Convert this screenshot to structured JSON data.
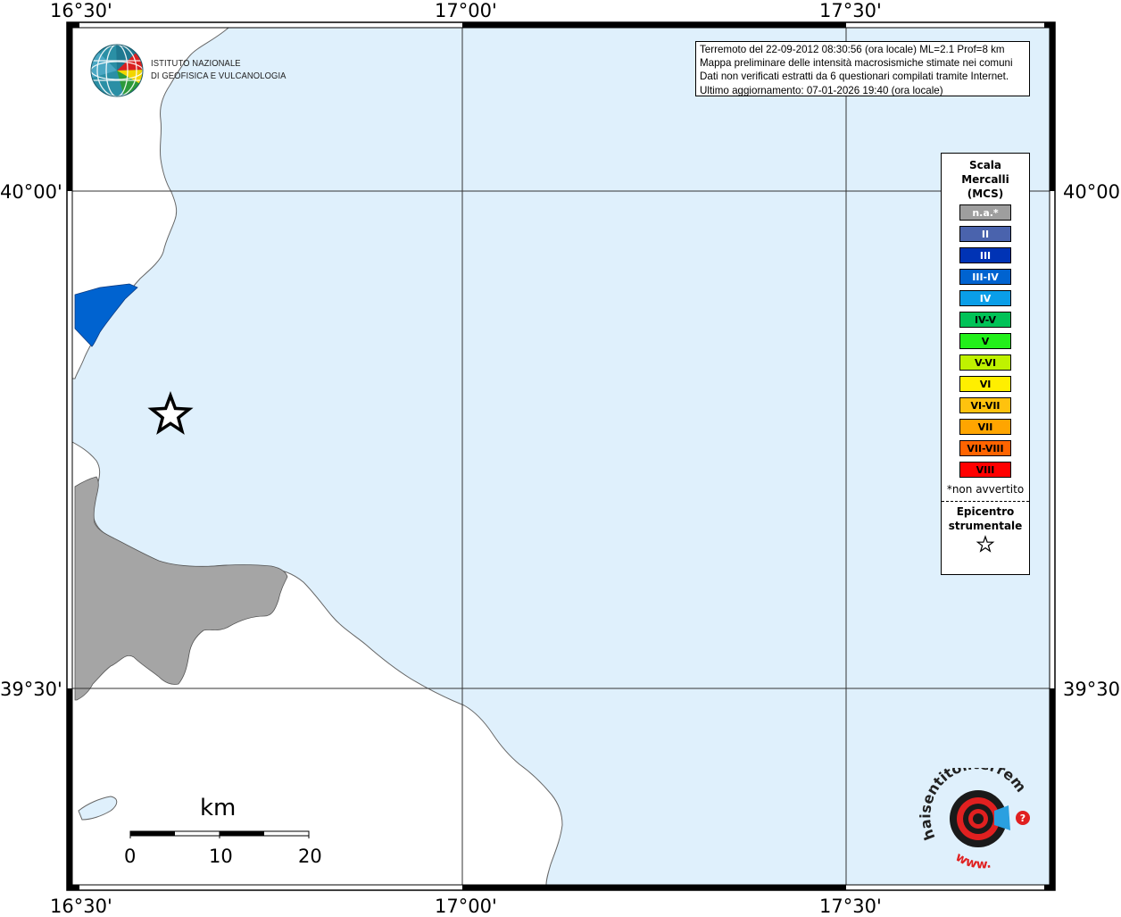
{
  "coords": {
    "top": [
      "16°30'",
      "17°00'",
      "17°30'"
    ],
    "bottom": [
      "16°30'",
      "17°00'",
      "17°30'"
    ],
    "left": [
      "40°00'",
      "39°30'"
    ],
    "right": [
      "40°00'",
      "39°30'"
    ]
  },
  "info": {
    "line1": "Terremoto del 22-09-2012 08:30:56 (ora locale) ML=2.1 Prof=8 km",
    "line2": "Mappa preliminare delle intensità macrosismiche stimate nei comuni",
    "line3": "Dati non verificati estratti da 6 questionari compilati tramite Internet.",
    "line4": "Ultimo aggiornamento: 07-01-2026 19:40 (ora locale)"
  },
  "logo": {
    "line1": "ISTITUTO NAZIONALE",
    "line2": "DI GEOFISICA E VULCANOLOGIA"
  },
  "legend": {
    "title": "Scala\nMercalli\n(MCS)",
    "items": [
      {
        "label": "n.a.*",
        "color": "#9e9e9e",
        "text_color": "#ffffff"
      },
      {
        "label": "II",
        "color": "#4a63ad",
        "text_color": "#ffffff"
      },
      {
        "label": "III",
        "color": "#0033b5",
        "text_color": "#ffffff"
      },
      {
        "label": "III-IV",
        "color": "#0063d0",
        "text_color": "#ffffff"
      },
      {
        "label": "IV",
        "color": "#0a9ee8",
        "text_color": "#ffffff"
      },
      {
        "label": "IV-V",
        "color": "#00c257",
        "text_color": "#000000"
      },
      {
        "label": "V",
        "color": "#22f01a",
        "text_color": "#000000"
      },
      {
        "label": "V-VI",
        "color": "#bff200",
        "text_color": "#000000"
      },
      {
        "label": "VI",
        "color": "#ffef00",
        "text_color": "#000000"
      },
      {
        "label": "VI-VII",
        "color": "#ffc20e",
        "text_color": "#000000"
      },
      {
        "label": "VII",
        "color": "#ffa500",
        "text_color": "#000000"
      },
      {
        "label": "VII-VIII",
        "color": "#ff6400",
        "text_color": "#000000"
      },
      {
        "label": "VIII",
        "color": "#ff0000",
        "text_color": "#000000"
      }
    ],
    "note": "*non avvertito",
    "epicenter_label": "Epicentro\nstrumentale"
  },
  "scale": {
    "unit": "km",
    "ticks": [
      "0",
      "10",
      "20"
    ]
  },
  "colors": {
    "sea": "#dff0fc",
    "land": "#ffffff",
    "not_felt": "#a5a5a5",
    "intensity_zone": "#0063d0"
  },
  "badge": {
    "text_top": "haisentitoilterremoto.it",
    "text_bottom": "www."
  }
}
